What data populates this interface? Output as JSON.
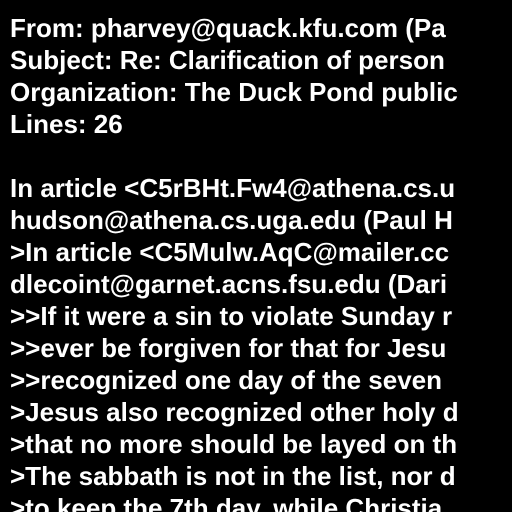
{
  "colors": {
    "background": "#000000",
    "text": "#ffffff"
  },
  "email": {
    "lines": [
      "From: pharvey@quack.kfu.com (Pa",
      "Subject: Re: Clarification of person",
      "Organization: The Duck Pond public",
      "Lines: 26",
      "",
      "In article <C5rBHt.Fw4@athena.cs.u",
      "hudson@athena.cs.uga.edu (Paul H",
      ">In article <C5Mulw.AqC@mailer.cc",
      "dlecoint@garnet.acns.fsu.edu (Dari",
      ">>If it were a sin to violate Sunday r",
      ">>ever be forgiven for that for Jesu",
      ">>recognized one day of the seven",
      ">Jesus also recognized other holy d",
      ">that no more should be layed on th",
      ">The sabbath is not in the list, nor d",
      ">to keep the 7th day, while Christia"
    ]
  }
}
